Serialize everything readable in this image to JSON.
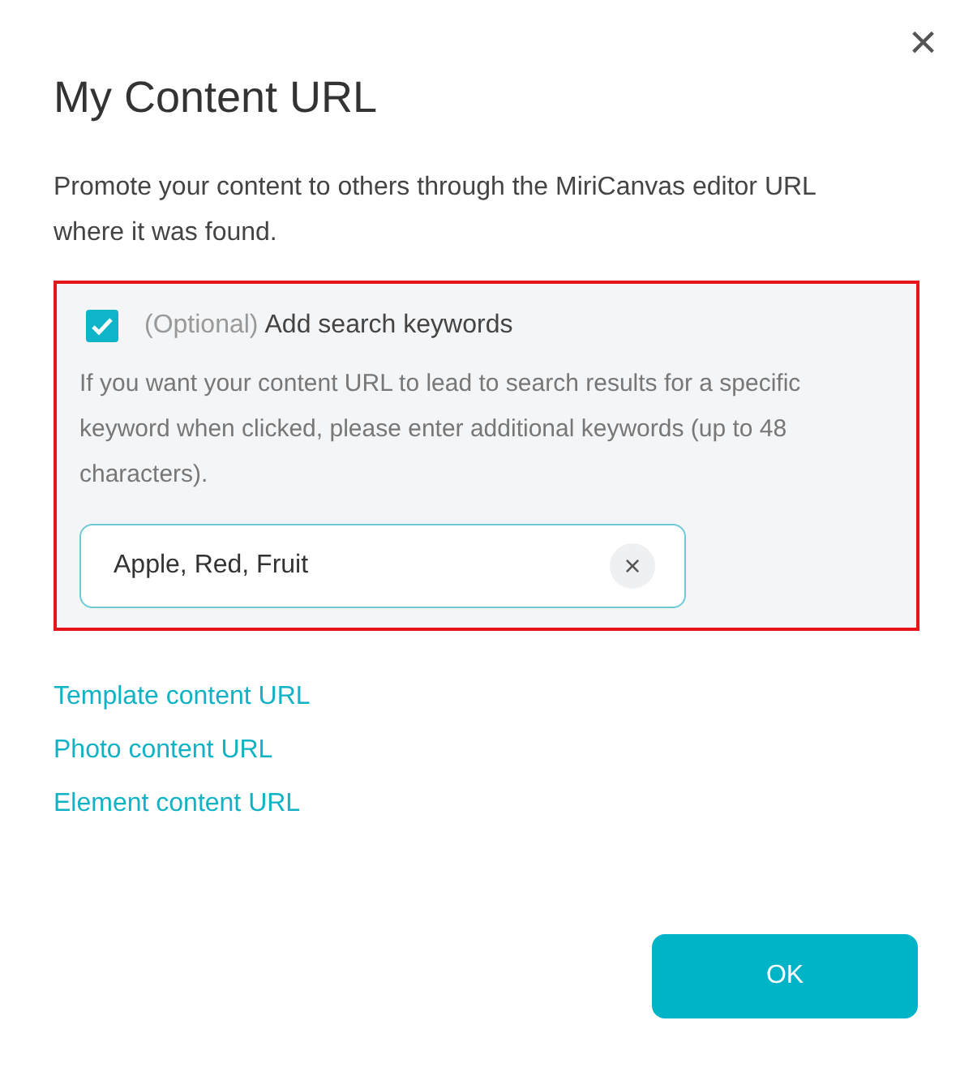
{
  "dialog": {
    "title": "My Content URL",
    "close": "×",
    "description": "Promote your content to others through the MiriCanvas editor URL where it was found."
  },
  "keywords_section": {
    "highlighted": true,
    "checked": true,
    "optional_note": "(Optional)",
    "label": "Add search keywords",
    "help": "If you want your content URL to lead to search results for a specific keyword when clicked, please enter additional keywords (up to 48 characters).",
    "field": {
      "value": "Apple, Red, Fruit",
      "clear": "×"
    }
  },
  "links": [
    "Template content URL",
    "Photo content URL",
    "Element content URL"
  ],
  "buttons": [
    "OK"
  ]
}
